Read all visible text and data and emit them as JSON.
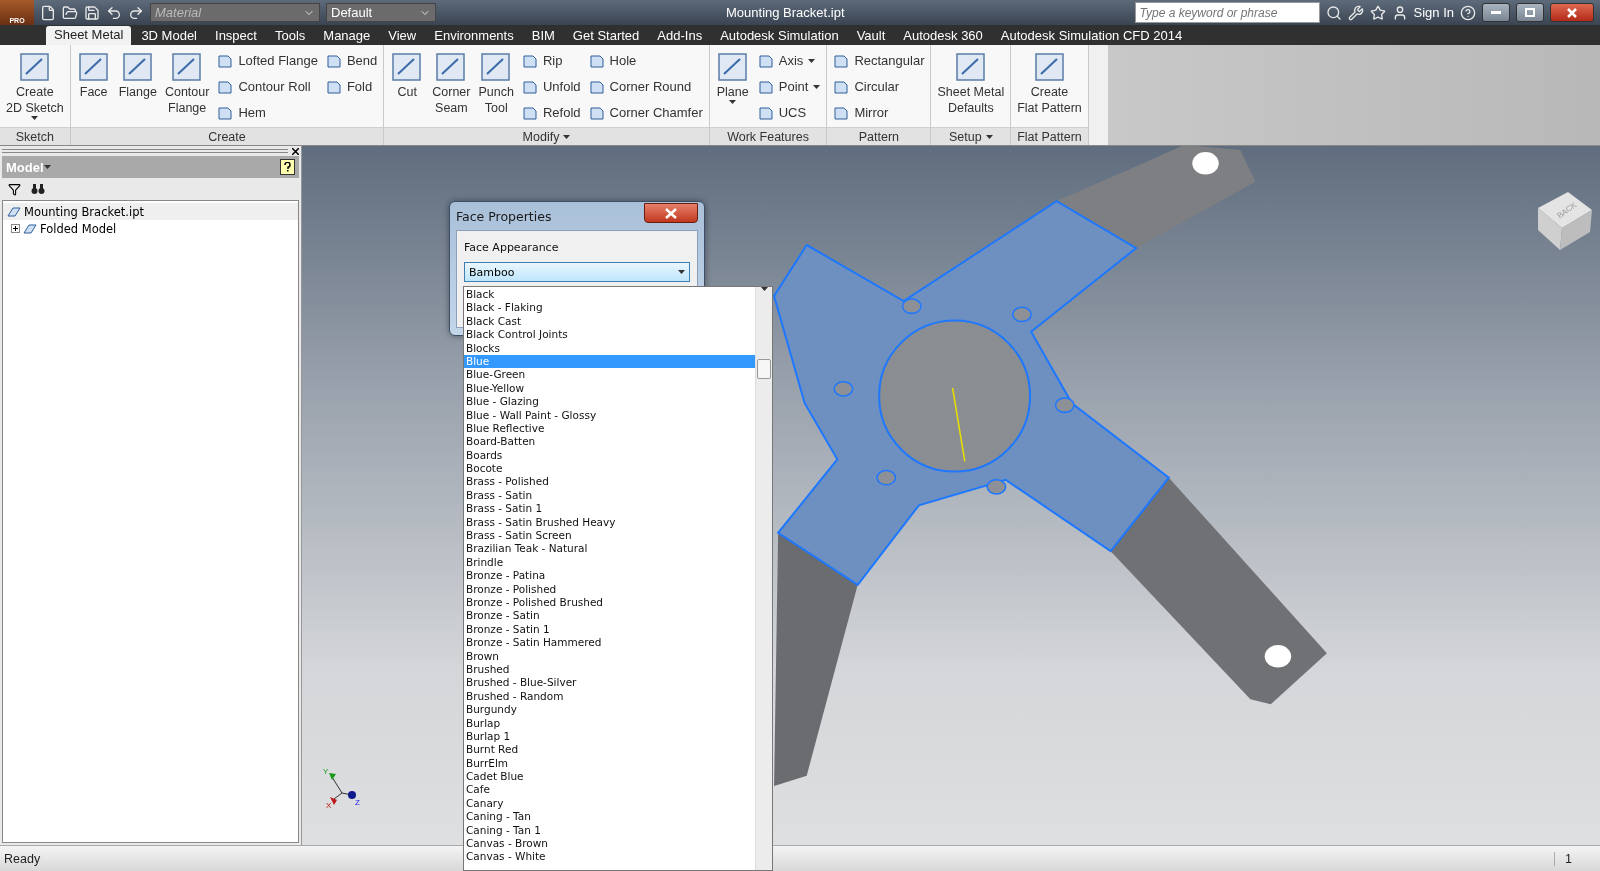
{
  "title_bar": {
    "app_badge": "PRO",
    "material_placeholder": "Material",
    "style_value": "Default",
    "document_title": "Mounting Bracket.ipt",
    "search_placeholder": "Type a keyword or phrase",
    "sign_in": "Sign In"
  },
  "tabs": [
    {
      "label": "Sheet Metal",
      "selected": true
    },
    {
      "label": "3D Model",
      "selected": false
    },
    {
      "label": "Inspect",
      "selected": false
    },
    {
      "label": "Tools",
      "selected": false
    },
    {
      "label": "Manage",
      "selected": false
    },
    {
      "label": "View",
      "selected": false
    },
    {
      "label": "Environments",
      "selected": false
    },
    {
      "label": "BIM",
      "selected": false
    },
    {
      "label": "Get Started",
      "selected": false
    },
    {
      "label": "Add-Ins",
      "selected": false
    },
    {
      "label": "Autodesk Simulation",
      "selected": false
    },
    {
      "label": "Vault",
      "selected": false
    },
    {
      "label": "Autodesk 360",
      "selected": false
    },
    {
      "label": "Autodesk Simulation CFD 2014",
      "selected": false
    }
  ],
  "ribbon": {
    "panels": [
      {
        "label": "Sketch",
        "menu": false,
        "large": [
          {
            "label": "Create\n2D Sketch",
            "menu": true
          }
        ]
      },
      {
        "label": "Create",
        "menu": false,
        "large": [
          {
            "label": "Face",
            "menu": false
          },
          {
            "label": "Flange",
            "menu": false
          },
          {
            "label": "Contour\nFlange",
            "menu": false
          }
        ],
        "columns": [
          [
            {
              "label": "Lofted Flange",
              "menu": false
            },
            {
              "label": "Contour Roll",
              "menu": false
            },
            {
              "label": "Hem",
              "menu": false
            }
          ],
          [
            {
              "label": "Bend",
              "menu": false
            },
            {
              "label": "Fold",
              "menu": false
            }
          ]
        ]
      },
      {
        "label": "Modify",
        "menu": true,
        "large": [
          {
            "label": "Cut",
            "menu": false
          },
          {
            "label": "Corner\nSeam",
            "menu": false
          },
          {
            "label": "Punch\nTool",
            "menu": false
          }
        ],
        "columns": [
          [
            {
              "label": "Rip",
              "menu": false
            },
            {
              "label": "Unfold",
              "menu": false
            },
            {
              "label": "Refold",
              "menu": false
            }
          ],
          [
            {
              "label": "Hole",
              "menu": false
            },
            {
              "label": "Corner Round",
              "menu": false
            },
            {
              "label": "Corner Chamfer",
              "menu": false
            }
          ]
        ]
      },
      {
        "label": "Work Features",
        "menu": false,
        "large": [
          {
            "label": "Plane",
            "menu": true
          }
        ],
        "columns": [
          [
            {
              "label": "Axis",
              "menu": true
            },
            {
              "label": "Point",
              "menu": true
            },
            {
              "label": "UCS",
              "menu": false
            }
          ]
        ]
      },
      {
        "label": "Pattern",
        "menu": false,
        "columns": [
          [
            {
              "label": "Rectangular",
              "menu": false
            },
            {
              "label": "Circular",
              "menu": false
            },
            {
              "label": "Mirror",
              "menu": false
            }
          ]
        ]
      },
      {
        "label": "Setup",
        "menu": true,
        "large": [
          {
            "label": "Sheet Metal\nDefaults",
            "menu": false
          }
        ]
      },
      {
        "label": "Flat Pattern",
        "menu": false,
        "large": [
          {
            "label": "Create\nFlat Pattern",
            "menu": false
          }
        ]
      }
    ]
  },
  "browser": {
    "title": "Model",
    "tree": [
      {
        "label": "Mounting Bracket.ipt",
        "selected": true
      },
      {
        "label": "Folded Model",
        "selected": false,
        "expanded": false
      }
    ]
  },
  "dialog": {
    "title": "Face Properties",
    "field_label": "Face Appearance",
    "value": "Bamboo",
    "options": [
      {
        "label": "Black",
        "selected": false
      },
      {
        "label": "Black - Flaking",
        "selected": false
      },
      {
        "label": "Black Cast",
        "selected": false
      },
      {
        "label": "Black Control Joints",
        "selected": false
      },
      {
        "label": "Blocks",
        "selected": false
      },
      {
        "label": "Blue",
        "selected": true
      },
      {
        "label": "Blue-Green",
        "selected": false
      },
      {
        "label": "Blue-Yellow",
        "selected": false
      },
      {
        "label": "Blue - Glazing",
        "selected": false
      },
      {
        "label": "Blue - Wall Paint - Glossy",
        "selected": false
      },
      {
        "label": "Blue Reflective",
        "selected": false
      },
      {
        "label": "Board-Batten",
        "selected": false
      },
      {
        "label": "Boards",
        "selected": false
      },
      {
        "label": "Bocote",
        "selected": false
      },
      {
        "label": "Brass - Polished",
        "selected": false
      },
      {
        "label": "Brass - Satin",
        "selected": false
      },
      {
        "label": "Brass - Satin 1",
        "selected": false
      },
      {
        "label": "Brass - Satin Brushed Heavy",
        "selected": false
      },
      {
        "label": "Brass - Satin Screen",
        "selected": false
      },
      {
        "label": "Brazilian Teak - Natural",
        "selected": false
      },
      {
        "label": "Brindle",
        "selected": false
      },
      {
        "label": "Bronze - Patina",
        "selected": false
      },
      {
        "label": "Bronze - Polished",
        "selected": false
      },
      {
        "label": "Bronze - Polished Brushed",
        "selected": false
      },
      {
        "label": "Bronze - Satin",
        "selected": false
      },
      {
        "label": "Bronze - Satin 1",
        "selected": false
      },
      {
        "label": "Bronze - Satin Hammered",
        "selected": false
      },
      {
        "label": "Brown",
        "selected": false
      },
      {
        "label": "Brushed",
        "selected": false
      },
      {
        "label": "Brushed - Blue-Silver",
        "selected": false
      },
      {
        "label": "Brushed - Random",
        "selected": false
      },
      {
        "label": "Burgundy",
        "selected": false
      },
      {
        "label": "Burlap",
        "selected": false
      },
      {
        "label": "Burlap 1",
        "selected": false
      },
      {
        "label": "Burnt Red",
        "selected": false
      },
      {
        "label": "BurrElm",
        "selected": false
      },
      {
        "label": "Cadet Blue",
        "selected": false
      },
      {
        "label": "Cafe",
        "selected": false
      },
      {
        "label": "Canary",
        "selected": false
      },
      {
        "label": "Caning - Tan",
        "selected": false
      },
      {
        "label": "Caning - Tan 1",
        "selected": false
      },
      {
        "label": "Canvas - Brown",
        "selected": false
      },
      {
        "label": "Canvas - White",
        "selected": false
      }
    ]
  },
  "triad": {
    "y": "Y",
    "z": "Z",
    "x": "X"
  },
  "viewcube": {
    "face": "BACK"
  },
  "status_bar": {
    "message": "Ready",
    "count": "1"
  }
}
